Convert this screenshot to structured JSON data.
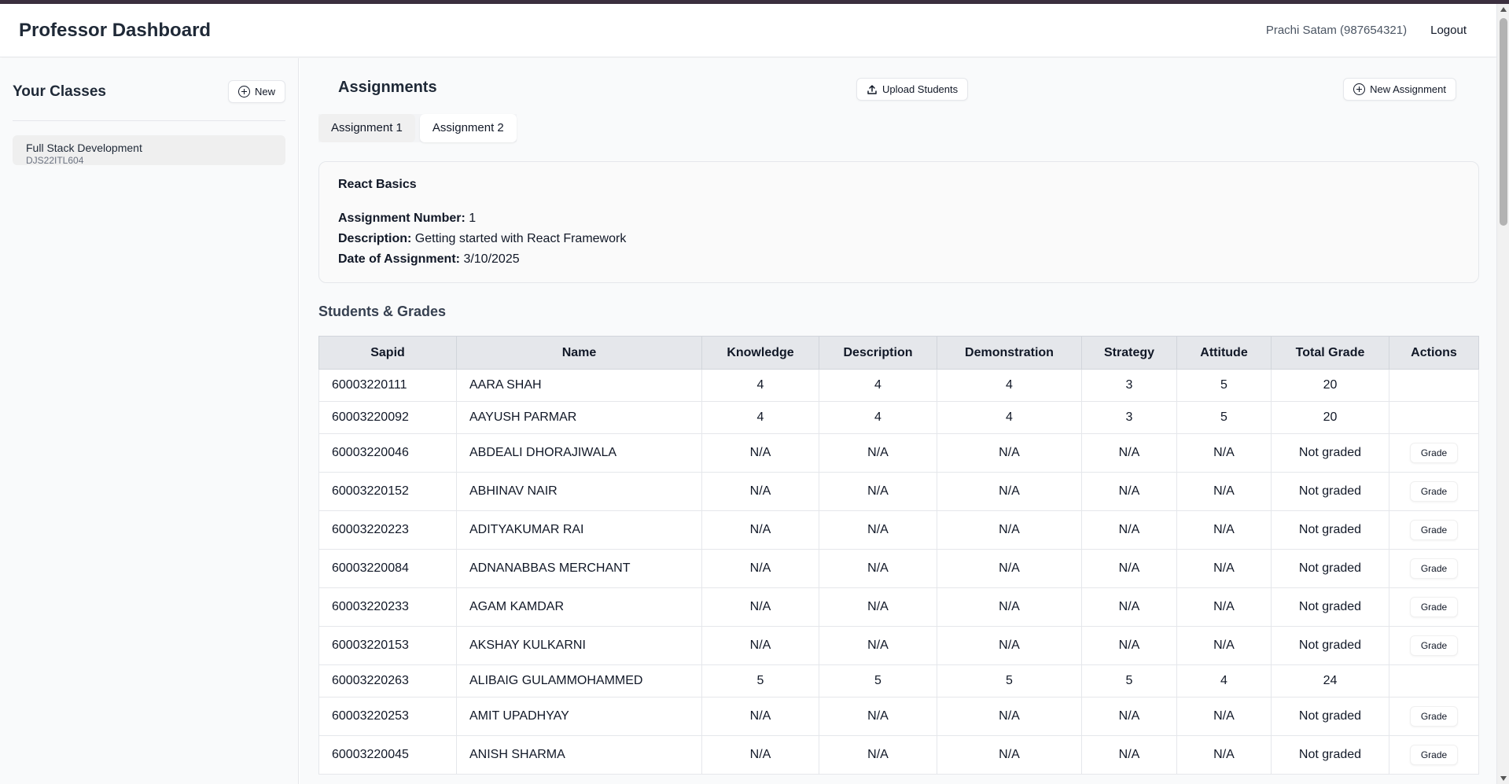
{
  "header": {
    "title": "Professor Dashboard",
    "user": "Prachi Satam (987654321)",
    "logout_label": "Logout"
  },
  "sidebar": {
    "title": "Your Classes",
    "new_label": "New",
    "classes": [
      {
        "name": "Full Stack Development",
        "code": "DJS22ITL604"
      }
    ]
  },
  "assignments": {
    "title": "Assignments",
    "upload_label": "Upload Students",
    "new_label": "New Assignment",
    "tabs": [
      {
        "label": "Assignment 1"
      },
      {
        "label": "Assignment 2"
      }
    ],
    "details": {
      "title": "React Basics",
      "number_label": "Assignment Number:",
      "number_value": "1",
      "description_label": "Description:",
      "description_value": "Getting started with React Framework",
      "date_label": "Date of Assignment:",
      "date_value": "3/10/2025"
    }
  },
  "grades": {
    "title": "Students & Grades",
    "columns": [
      "Sapid",
      "Name",
      "Knowledge",
      "Description",
      "Demonstration",
      "Strategy",
      "Attitude",
      "Total Grade",
      "Actions"
    ],
    "grade_label": "Grade",
    "rows": [
      {
        "sapid": "60003220111",
        "name": "AARA SHAH",
        "knowledge": "4",
        "description": "4",
        "demonstration": "4",
        "strategy": "3",
        "attitude": "5",
        "total": "20",
        "action": ""
      },
      {
        "sapid": "60003220092",
        "name": "AAYUSH PARMAR",
        "knowledge": "4",
        "description": "4",
        "demonstration": "4",
        "strategy": "3",
        "attitude": "5",
        "total": "20",
        "action": ""
      },
      {
        "sapid": "60003220046",
        "name": "ABDEALI DHORAJIWALA",
        "knowledge": "N/A",
        "description": "N/A",
        "demonstration": "N/A",
        "strategy": "N/A",
        "attitude": "N/A",
        "total": "Not graded",
        "action": "Grade"
      },
      {
        "sapid": "60003220152",
        "name": "ABHINAV NAIR",
        "knowledge": "N/A",
        "description": "N/A",
        "demonstration": "N/A",
        "strategy": "N/A",
        "attitude": "N/A",
        "total": "Not graded",
        "action": "Grade"
      },
      {
        "sapid": "60003220223",
        "name": "ADITYAKUMAR RAI",
        "knowledge": "N/A",
        "description": "N/A",
        "demonstration": "N/A",
        "strategy": "N/A",
        "attitude": "N/A",
        "total": "Not graded",
        "action": "Grade"
      },
      {
        "sapid": "60003220084",
        "name": "ADNANABBAS MERCHANT",
        "knowledge": "N/A",
        "description": "N/A",
        "demonstration": "N/A",
        "strategy": "N/A",
        "attitude": "N/A",
        "total": "Not graded",
        "action": "Grade"
      },
      {
        "sapid": "60003220233",
        "name": "AGAM KAMDAR",
        "knowledge": "N/A",
        "description": "N/A",
        "demonstration": "N/A",
        "strategy": "N/A",
        "attitude": "N/A",
        "total": "Not graded",
        "action": "Grade"
      },
      {
        "sapid": "60003220153",
        "name": "AKSHAY KULKARNI",
        "knowledge": "N/A",
        "description": "N/A",
        "demonstration": "N/A",
        "strategy": "N/A",
        "attitude": "N/A",
        "total": "Not graded",
        "action": "Grade"
      },
      {
        "sapid": "60003220263",
        "name": "ALIBAIG GULAMMOHAMMED",
        "knowledge": "5",
        "description": "5",
        "demonstration": "5",
        "strategy": "5",
        "attitude": "4",
        "total": "24",
        "action": ""
      },
      {
        "sapid": "60003220253",
        "name": "AMIT UPADHYAY",
        "knowledge": "N/A",
        "description": "N/A",
        "demonstration": "N/A",
        "strategy": "N/A",
        "attitude": "N/A",
        "total": "Not graded",
        "action": "Grade"
      },
      {
        "sapid": "60003220045",
        "name": "ANISH SHARMA",
        "knowledge": "N/A",
        "description": "N/A",
        "demonstration": "N/A",
        "strategy": "N/A",
        "attitude": "N/A",
        "total": "Not graded",
        "action": "Grade"
      }
    ]
  }
}
